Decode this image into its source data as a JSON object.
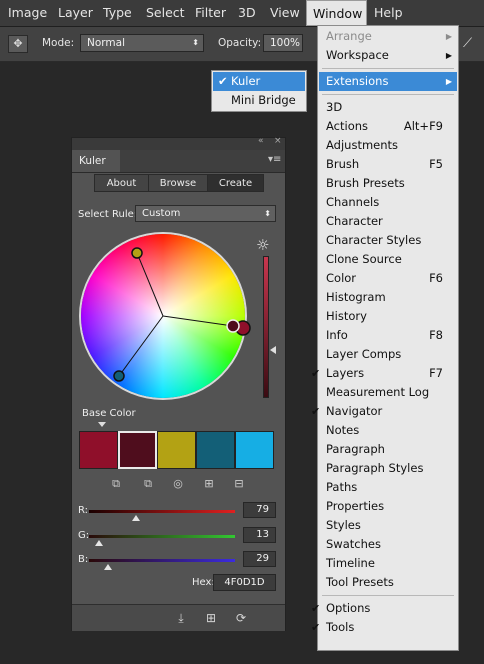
{
  "menubar": {
    "items": [
      "Image",
      "Layer",
      "Type",
      "Select",
      "Filter",
      "3D",
      "View",
      "Window",
      "Help"
    ],
    "active": "Window"
  },
  "options_bar": {
    "mode_label": "Mode:",
    "mode_value": "Normal",
    "opacity_label": "Opacity:",
    "opacity_value": "100%"
  },
  "panel": {
    "title": "Kuler",
    "tabs": [
      "About",
      "Browse",
      "Create"
    ],
    "selected_tab": "Create",
    "select_rule_label": "Select Rule:",
    "select_rule_value": "Custom",
    "base_color_label": "Base Color",
    "swatches": [
      "#8f0f2a",
      "#4f0d1d",
      "#b3a214",
      "#135f77",
      "#16aee4"
    ],
    "selected_swatch": 1,
    "channels": [
      {
        "label": "R:",
        "value": "79",
        "color": "#d21e1e"
      },
      {
        "label": "G:",
        "value": "13",
        "color": "#2fbf2f"
      },
      {
        "label": "B:",
        "value": "29",
        "color": "#3d2fd6"
      }
    ],
    "hex_label": "Hex:",
    "hex_value": "4F0D1D"
  },
  "window_menu": {
    "items": [
      {
        "label": "Arrange",
        "disabled": true,
        "submenu": true
      },
      {
        "label": "Workspace",
        "submenu": true
      },
      {
        "sep": true
      },
      {
        "label": "Extensions",
        "submenu": true,
        "highlight": true
      },
      {
        "sep": true
      },
      {
        "label": "3D"
      },
      {
        "label": "Actions",
        "shortcut": "Alt+F9"
      },
      {
        "label": "Adjustments"
      },
      {
        "label": "Brush",
        "shortcut": "F5"
      },
      {
        "label": "Brush Presets"
      },
      {
        "label": "Channels"
      },
      {
        "label": "Character"
      },
      {
        "label": "Character Styles"
      },
      {
        "label": "Clone Source"
      },
      {
        "label": "Color",
        "shortcut": "F6"
      },
      {
        "label": "Histogram"
      },
      {
        "label": "History"
      },
      {
        "label": "Info",
        "shortcut": "F8"
      },
      {
        "label": "Layer Comps"
      },
      {
        "label": "Layers",
        "shortcut": "F7",
        "checked": true
      },
      {
        "label": "Measurement Log"
      },
      {
        "label": "Navigator",
        "checked": true
      },
      {
        "label": "Notes"
      },
      {
        "label": "Paragraph"
      },
      {
        "label": "Paragraph Styles"
      },
      {
        "label": "Paths"
      },
      {
        "label": "Properties"
      },
      {
        "label": "Styles"
      },
      {
        "label": "Swatches"
      },
      {
        "label": "Timeline"
      },
      {
        "label": "Tool Presets"
      },
      {
        "sep": true
      },
      {
        "label": "Options",
        "checked": true
      },
      {
        "label": "Tools",
        "checked": true
      }
    ]
  },
  "extensions_submenu": {
    "items": [
      {
        "label": "Kuler",
        "checked": true,
        "highlight": true
      },
      {
        "label": "Mini Bridge"
      }
    ]
  }
}
